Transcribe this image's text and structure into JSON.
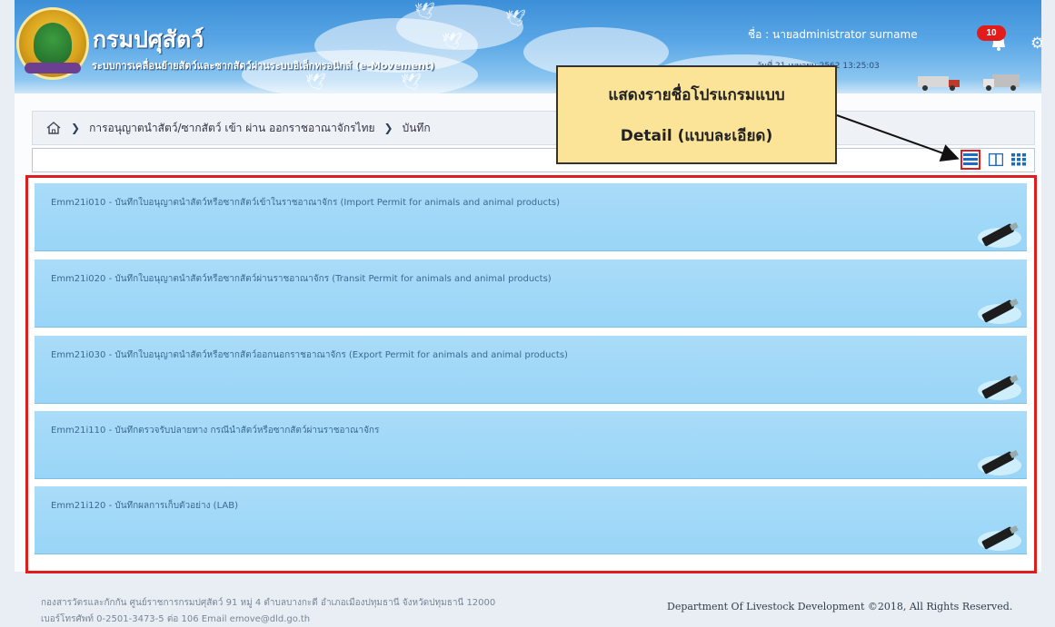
{
  "header": {
    "title": "กรมปศุสัตว์",
    "subtitle": "ระบบการเคลื่อนย้ายสัตว์และซากสัตว์ผ่านระบบอิเล็กทรอนิกส์ (e-Movement)",
    "user": "ชื่อ : นายadministrator surname",
    "date": "วันที่ 21 เมษายน 2562 13:25:03",
    "notification_count": "10",
    "icons": [
      "department-logo",
      "bell-icon",
      "gear-icon"
    ]
  },
  "callout": {
    "line1": "แสดงรายชื่อโปรแกรมแบบ",
    "line2": "Detail (แบบละเอียด)"
  },
  "breadcrumb": {
    "items": [
      "การอนุญาตนำสัตว์/ซากสัตว์ เข้า ผ่าน ออกราชอาณาจักรไทย",
      "บันทึก"
    ]
  },
  "view_modes": [
    "detail-view",
    "split-view",
    "grid-view"
  ],
  "programs": [
    {
      "title": "Emm21i010 - บันทึกใบอนุญาตนำสัตว์หรือซากสัตว์เข้าในราชอาณาจักร (Import Permit for animals and animal products)"
    },
    {
      "title": "Emm21i020 - บันทึกใบอนุญาตนำสัตว์หรือซากสัตว์ผ่านราชอาณาจักร (Transit Permit for animals and animal products)"
    },
    {
      "title": "Emm21i030 - บันทึกใบอนุญาตนำสัตว์หรือซากสัตว์ออกนอกราชอาณาจักร (Export Permit for animals and animal products)"
    },
    {
      "title": "Emm21i110 - บันทึกตรวจรับปลายทาง กรณีนำสัตว์หรือซากสัตว์ผ่านราชอาณาจักร"
    },
    {
      "title": "Emm21i120 - บันทึกผลการเก็บตัวอย่าง (LAB)"
    }
  ],
  "footer": {
    "address1": "กองสารวัตรและกักกัน ศูนย์ราชการกรมปศุสัตว์ 91 หมู่ 4 ตำบลบางกะดี อำเภอเมืองปทุมธานี จังหวัดปทุมธานี 12000",
    "address2": "เบอร์โทรศัพท์ 0-2501-3473-5 ต่อ 106 Email emove@dld.go.th",
    "copyright": "Department Of Livestock Development ©2018, All Rights Reserved."
  },
  "colors": {
    "accent_red": "#e01d1d",
    "card_blue": "#a9dcf8",
    "callout_yellow": "#fbe497"
  }
}
